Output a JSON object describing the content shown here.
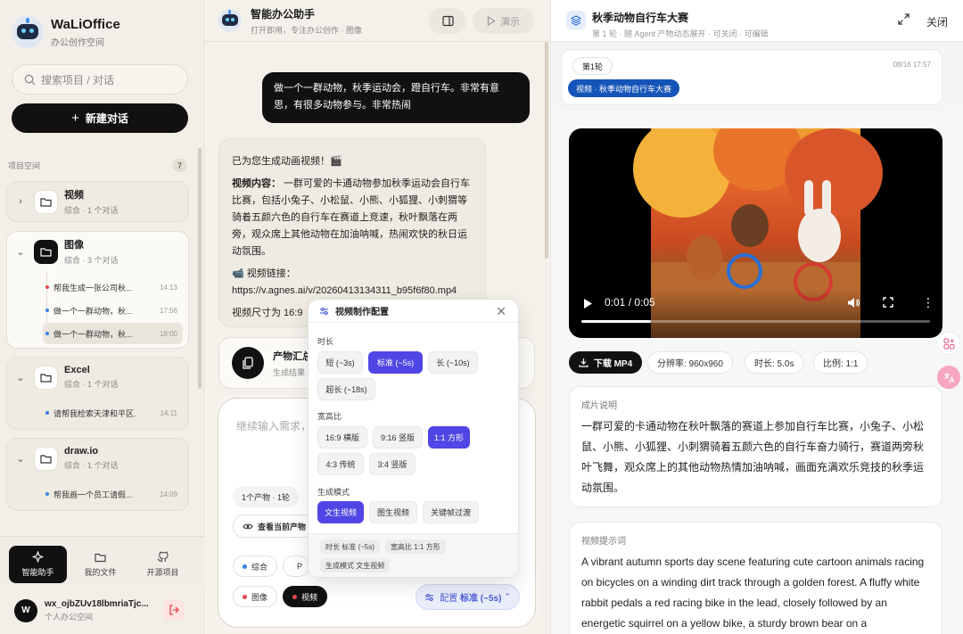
{
  "sidebar": {
    "app_name": "WaLiOffice",
    "app_subtitle": "办公创作空间",
    "search_placeholder": "搜索项目 / 对话",
    "new_chat": "新建对话",
    "section_label": "项目空间",
    "section_count": "7",
    "projects": [
      {
        "name": "视频",
        "meta": "综合 · 1 个对话",
        "expanded": false,
        "conversations": []
      },
      {
        "name": "图像",
        "meta": "综合 · 3 个对话",
        "expanded": true,
        "conversations": [
          {
            "title": "帮我生成一张公司秋...",
            "time": "14:13"
          },
          {
            "title": "做一个一群动物，秋...",
            "time": "17:56"
          },
          {
            "title": "做一个一群动物，秋...",
            "time": "18:00",
            "selected": true
          }
        ]
      },
      {
        "name": "Excel",
        "meta": "综合 · 1 个对话",
        "expanded": true,
        "conversations": [
          {
            "title": "请帮我检索天津和平区...",
            "time": "14:11"
          }
        ]
      },
      {
        "name": "draw.io",
        "meta": "综合 · 1 个对话",
        "expanded": true,
        "conversations": [
          {
            "title": "帮我画一个员工请假...",
            "time": "14:09"
          }
        ]
      }
    ],
    "bottom_nav": [
      {
        "label": "智能助手",
        "icon": "sparkle-icon",
        "active": true
      },
      {
        "label": "我的文件",
        "icon": "folder-icon",
        "active": false
      },
      {
        "label": "开源项目",
        "icon": "github-icon",
        "active": false
      }
    ],
    "user": {
      "initial": "W",
      "name": "wx_ojbZUv18lbmriaTjc...",
      "space": "个人办公空间"
    }
  },
  "chat": {
    "title": "智能办公助手",
    "subtitle": "打开即用，专注办公创作 · 图像",
    "demo_label": "演示",
    "user_message": "做一个一群动物，秋季运动会，蹬自行车。非常有意思，有很多动物参与。非常热闹",
    "assistant": {
      "intro": "已为您生成动画视频！🎬",
      "content_label": "视频内容：",
      "content_text": "一群可爱的卡通动物参加秋季运动会自行车比赛，包括小兔子、小松鼠、小熊、小狐狸、小刺猬等骑着五颜六色的自行车在赛道上竞速，秋叶飘落在两旁，观众席上其他动物在加油呐喊，热闹欢快的秋日运动氛围。",
      "link_label": "📹 视频链接：",
      "link_url": "https://v.agnes.ai/v/20260413134311_b95f6f80.mp4",
      "size_text": "视频尺寸为 16:9"
    },
    "artifact": {
      "title": "产物汇总",
      "subtitle": "生成结果"
    },
    "input_placeholder": "继续输入需求，",
    "artifact_count": "1个产物 · 1轮",
    "view_artifacts": "查看当前产物",
    "modes": [
      {
        "label": "综合",
        "color": "#3a7ee9"
      },
      {
        "label": "P",
        "color": "#5046e5"
      },
      {
        "label": "图像",
        "color": "#e5484d"
      },
      {
        "label": "视频",
        "color": "#e5484d"
      }
    ],
    "config_label": "配置",
    "config_value": "标准 (~5s)"
  },
  "config_popup": {
    "title": "视频制作配置",
    "duration_label": "时长",
    "durations": [
      "短 (~3s)",
      "标准 (~5s)",
      "长 (~10s)",
      "超长 (~18s)"
    ],
    "duration_selected": "标准 (~5s)",
    "ratio_label": "宽高比",
    "ratios": [
      "16:9 横版",
      "9:16 竖版",
      "1:1 方形",
      "4:3 传统",
      "3:4 竖版"
    ],
    "ratio_selected": "1:1 方形",
    "mode_label": "生成模式",
    "modes": [
      "文生视频",
      "图生视频",
      "关键帧过渡"
    ],
    "mode_selected": "文生视频",
    "summary": [
      "时长 标准 (~5s)",
      "宽高比 1:1 方形",
      "生成模式 文生视频"
    ]
  },
  "preview": {
    "title": "秋季动物自行车大赛",
    "subtitle": "第 1 轮 · 随 Agent 产物动态展开 · 可关闭 · 可编辑",
    "close_label": "关闭",
    "round_label": "第1轮",
    "round_date": "08/16 17:57",
    "artifact_tag": "视频 · 秋季动物自行车大赛",
    "video_time": "0:01 / 0:05",
    "video_progress": 0.2,
    "download_label": "下载 MP4",
    "resolution": "分辨率: 960x960",
    "duration": "时长: 5.0s",
    "ratio": "比例: 1:1",
    "description_heading": "成片说明",
    "description": "一群可爱的卡通动物在秋叶飘落的赛道上参加自行车比赛，小兔子、小松鼠、小熊、小狐狸、小刺猬骑着五颜六色的自行车奋力骑行，赛道两旁秋叶飞舞，观众席上的其他动物热情加油呐喊，画面充满欢乐竞技的秋季运动氛围。",
    "prompt_heading": "视频提示词",
    "prompt": "A vibrant autumn sports day scene featuring cute cartoon animals racing on bicycles on a winding dirt track through a golden forest. A fluffy white rabbit pedals a red racing bike in the lead, closely followed by an energetic squirrel on a yellow bike, a sturdy brown bear on a"
  }
}
